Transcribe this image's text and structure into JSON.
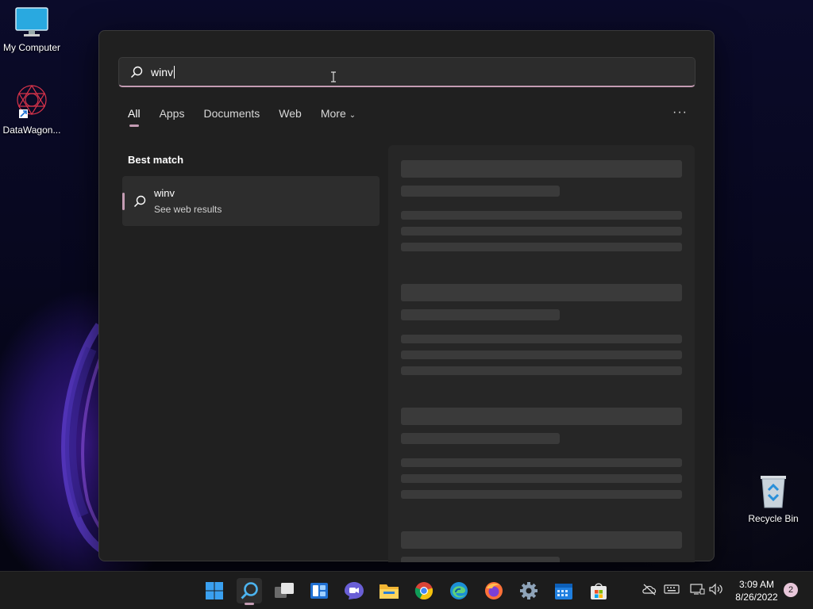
{
  "desktop": {
    "icons": [
      {
        "label": "My Computer"
      },
      {
        "label": "DataWagon..."
      },
      {
        "label": "Recycle Bin"
      }
    ]
  },
  "search": {
    "query": "winv",
    "tabs": [
      "All",
      "Apps",
      "Documents",
      "Web",
      "More"
    ],
    "active_tab": "All",
    "more_menu": "···",
    "best_match_title": "Best match",
    "result": {
      "title": "winv",
      "subtitle": "See web results"
    }
  },
  "taskbar": {
    "apps": [
      "start-icon",
      "search-icon",
      "task-view-icon",
      "widgets-icon",
      "teams-chat-icon",
      "file-explorer-icon",
      "chrome-icon",
      "edge-icon",
      "firefox-icon",
      "settings-icon",
      "calendar-icon",
      "store-icon"
    ],
    "active_app": "search-icon",
    "tray_icons": [
      "onedrive-icon",
      "keyboard-icon",
      "network-icon",
      "volume-icon"
    ],
    "time": "3:09 AM",
    "date": "8/26/2022",
    "notification_count": "2"
  },
  "colors": {
    "accent": "#c49cb3",
    "panel_bg": "#202020",
    "skeleton": "#3a3a3a"
  }
}
